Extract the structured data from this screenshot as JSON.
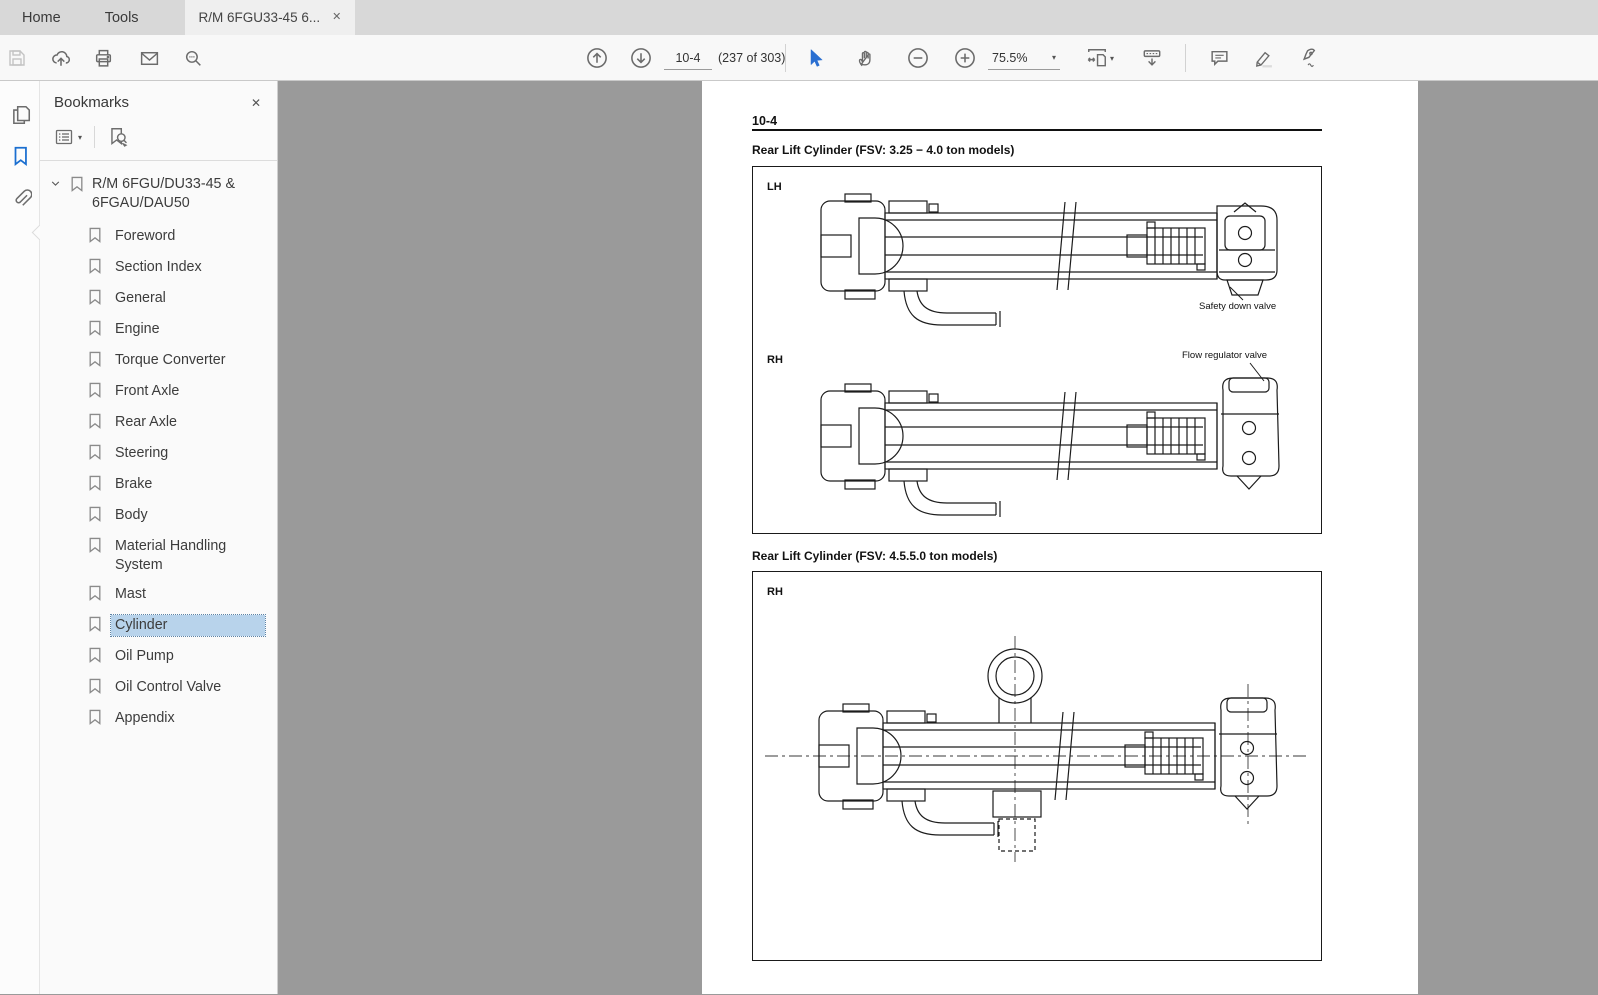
{
  "window": {
    "tabs": {
      "home": "Home",
      "tools": "Tools",
      "document": "R/M 6FGU33-45 6..."
    }
  },
  "toolbar": {
    "page_field": "10-4",
    "page_count": "(237 of 303)",
    "zoom_field": "75.5%"
  },
  "bookmarks": {
    "title": "Bookmarks",
    "root_label": "R/M 6FGU/DU33-45 & 6FGAU/DAU50",
    "items": [
      "Foreword",
      "Section Index",
      "General",
      "Engine",
      "Torque Converter",
      "Front Axle",
      "Rear Axle",
      "Steering",
      "Brake",
      "Body",
      "Material Handling System",
      "Mast",
      "Cylinder",
      "Oil Pump",
      "Oil Control Valve",
      "Appendix"
    ],
    "selected": "Cylinder"
  },
  "document": {
    "page_label": "10-4",
    "figures": [
      {
        "title": "Rear Lift Cylinder (FSV:  3.25 − 4.0 ton models)",
        "views": [
          {
            "label": "LH",
            "callout": "Safety down valve"
          },
          {
            "label": "RH",
            "callout": "Flow regulator valve"
          }
        ]
      },
      {
        "title": "Rear Lift Cylinder (FSV:  4.5.5.0 ton models)",
        "views": [
          {
            "label": "RH"
          }
        ]
      }
    ]
  },
  "glyphs": {
    "close": "✕",
    "caret_down": "▾",
    "collapse_left": "◀"
  },
  "icons": {
    "save-icon": "floppy disk (disabled)",
    "share-cloud-icon": "cloud with up arrow",
    "print-icon": "printer",
    "email-icon": "envelope",
    "search-icon": "magnifier",
    "page-up-icon": "circled up arrow",
    "page-down-icon": "circled down arrow",
    "select-tool-icon": "blue cursor arrow",
    "hand-tool-icon": "hand",
    "zoom-out-icon": "circled minus",
    "zoom-in-icon": "circled plus",
    "fit-width-icon": "page with width arrows",
    "reading-mode-icon": "toolbar with down arrow",
    "comment-icon": "speech bubble",
    "highlight-icon": "highlighter pen",
    "fill-sign-icon": "fountain pen nib",
    "page-thumbnails-icon": "stacked pages",
    "bookmarks-rail-icon": "blue bookmark flag",
    "attachments-icon": "paperclip",
    "bookmark-options-icon": "list panel",
    "bookmark-search-icon": "bookmark with magnifier",
    "bookmark-icon": "bookmark flag",
    "chevron-down-icon": "expanded chevron"
  },
  "colors": {
    "accent_blue": "#1b6fd0",
    "selection_bg": "#b8d3eb",
    "canvas_gray": "#9a9a9a"
  }
}
